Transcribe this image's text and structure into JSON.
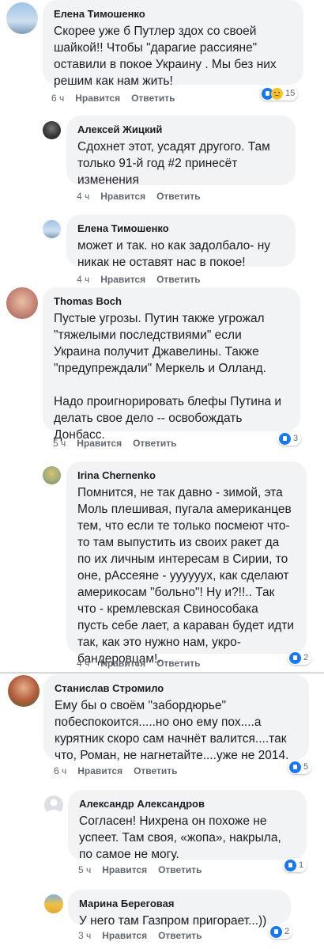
{
  "comments": [
    {
      "name": "Елена Тимошенко",
      "text": "Скорее уже б  Путлер здох со своей\nшайкой!! Чтобы \"дарагие рассияне\"\nоставили в покое Украину . Мы без них\nрешим как нам жить!",
      "time": "6 ч",
      "like": "Нравится",
      "reply": "Ответить",
      "reactions": "15",
      "reaction_icons": [
        "like-icon",
        "sad-icon"
      ],
      "avatar_color": "#8fb4d6"
    },
    {
      "name": "Алексей Жицкий",
      "text": "Сдохнет этот, усадят другого. Там\nтолько 91-й год #2 принесёт\nизменения",
      "time": "4 ч",
      "like": "Нравится",
      "reply": "Ответить",
      "avatar_color": "#3a3a3a"
    },
    {
      "name": "Елена Тимошенко",
      "text": "может и так. но как задолбало- ну\nникак не оставят нас в покое!",
      "time": "4 ч",
      "like": "Нравится",
      "reply": "Ответить",
      "avatar_color": "#8fb4d6"
    },
    {
      "name": "Thomas Boch",
      "text": "Пустые угрозы. Путин также угрожал\n\"тяжелыми последствиями\" если\nУкраина получит Джавелины. Также\n\"предупреждали\" Меркель и Олланд.\n\nНадо проигнорировать блефы Путина и\nделать свое дело -- освобождать\nДонбасс.",
      "time": "5 ч",
      "like": "Нравится",
      "reply": "Ответить",
      "reactions": "3",
      "reaction_icons": [
        "like-icon"
      ],
      "avatar_color": "#c98a7a"
    },
    {
      "name": "Irina Chernenko",
      "text": "Помнится, не так давно - зимой, эта\nМоль плешивая, пугала американцев\nтем, что если те только посмеют что-\nто там выпустить из своих ракет да\nпо их личным интересам в Сирии, то\nоне, рАссеяне - ууууууx, как сделают\nамерикосам \"больно\"! Ну и?!!.. Так\nчто - кремлевская Свинособака\nпусть себе лает, а караван будет идти\nтак, как это нужно нам, укро-\nбандеровцам!...",
      "time": "4 ч",
      "like": "Нравится",
      "reply": "Ответить",
      "reactions": "2",
      "reaction_icons": [
        "like-icon"
      ],
      "avatar_color": "#9fae7a"
    },
    {
      "name": "Станислав Стромило",
      "text": "Ему бы о своём \"забордюрье\"\nпобеспокоится.....но оно ему пох....а\nкурятник скоро сам начнёт валится....так\nчто, Роман, не нагнетайте....уже не 2014.",
      "time": "6 ч",
      "like": "Нравится",
      "reply": "Ответить",
      "reactions": "5",
      "reaction_icons": [
        "like-icon"
      ],
      "avatar_color": "#b05a3a"
    },
    {
      "name": "Александр Александров",
      "text": "Согласен! Нихрена он похоже не\nуспеет.  Там своя, «жопа», накрыла,\nпо самое не могу.",
      "time": "5 ч",
      "like": "Нравится",
      "reply": "Ответить",
      "reactions": "1",
      "reaction_icons": [
        "like-icon"
      ],
      "avatar_color": "#dcdfe3"
    },
    {
      "name": "Марина Береговая",
      "text": "У него там Газпром пригорает...))",
      "time": "3 ч",
      "like": "Нравится",
      "reply": "Ответить",
      "reactions": "2",
      "reaction_icons": [
        "like-icon"
      ],
      "avatar_color": "#e0a73a"
    }
  ],
  "colors": {
    "bubble": "#f2f3f5",
    "meta": "#606770",
    "like_blue": "#1877f2"
  }
}
